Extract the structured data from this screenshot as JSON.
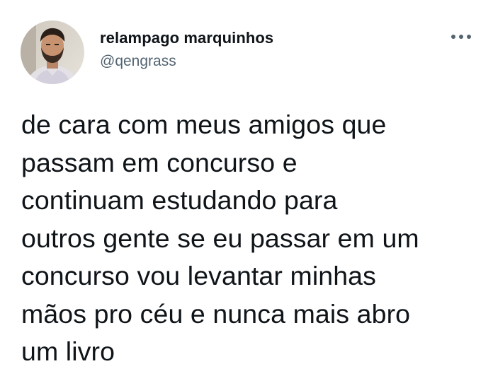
{
  "tweet": {
    "author": {
      "display_name": "relampago marquinhos",
      "handle": "@qengrass",
      "avatar_icon": "user-avatar-photo"
    },
    "more_icon": "more-options-icon",
    "text": "de cara com meus amigos que\npassam em concurso e\ncontinuam estudando para\noutros gente se eu passar em um\nconcurso vou levantar minhas\nmãos pro céu e nunca mais abro\num livro"
  },
  "colors": {
    "text_primary": "#0f1419",
    "text_secondary": "#536471",
    "background": "#ffffff"
  }
}
